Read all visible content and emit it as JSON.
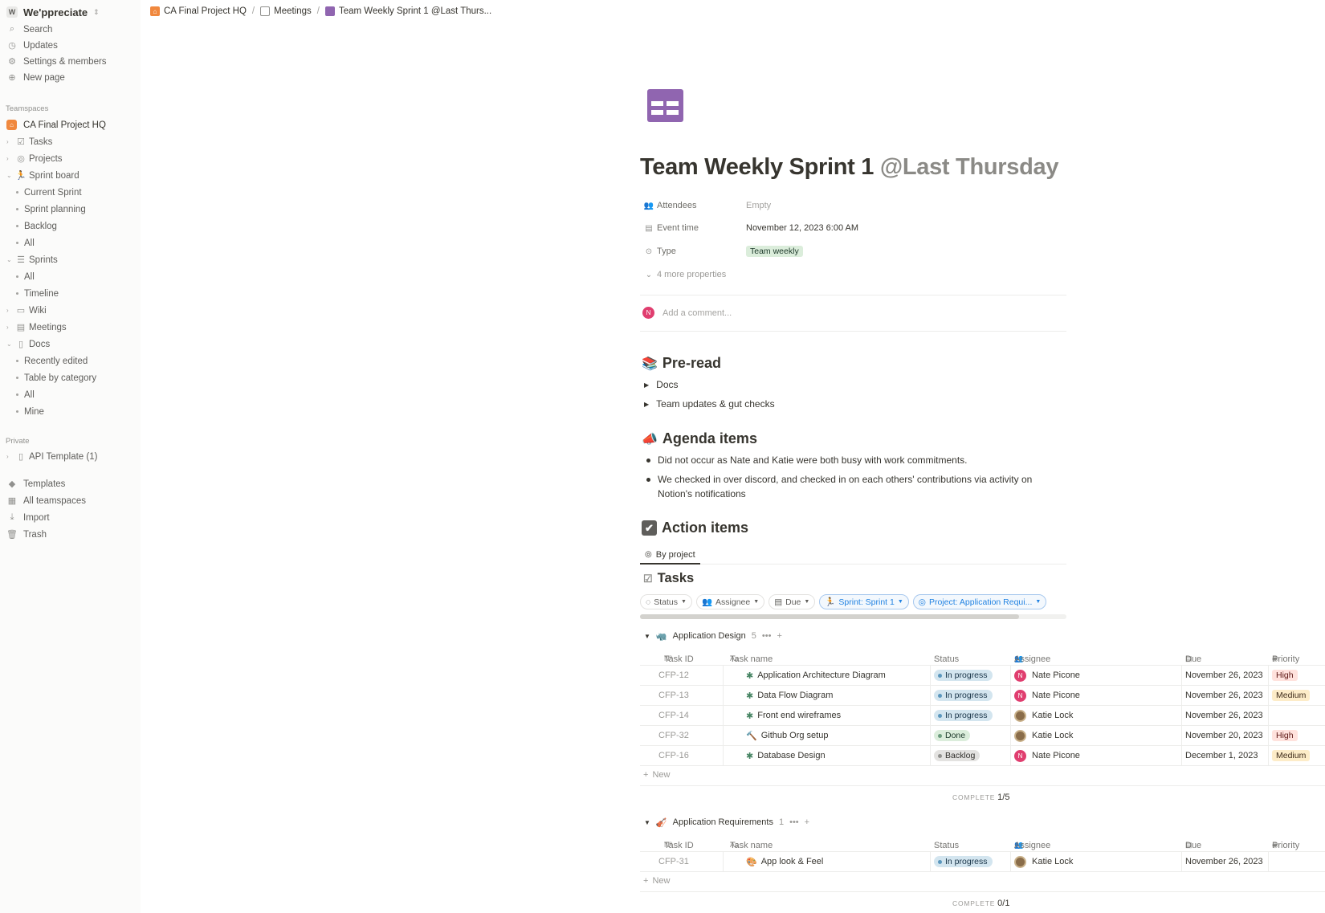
{
  "workspace": {
    "logo": "W",
    "name": "We'ppreciate"
  },
  "sidebar": {
    "top": [
      {
        "icon": "search-icon",
        "label": "Search"
      },
      {
        "icon": "clock-icon",
        "label": "Updates"
      },
      {
        "icon": "gear-icon",
        "label": "Settings & members"
      },
      {
        "icon": "plus-circle-icon",
        "label": "New page"
      }
    ],
    "teamspaces_label": "Teamspaces",
    "teamspace_name": "CA Final Project HQ",
    "tree": {
      "tasks": "Tasks",
      "projects": "Projects",
      "sprint_board": "Sprint board",
      "sprint_board_children": [
        "Current Sprint",
        "Sprint planning",
        "Backlog",
        "All"
      ],
      "sprints": "Sprints",
      "sprints_children": [
        "All",
        "Timeline"
      ],
      "wiki": "Wiki",
      "meetings": "Meetings",
      "docs": "Docs",
      "docs_children": [
        "Recently edited",
        "Table by category",
        "All",
        "Mine"
      ]
    },
    "private_label": "Private",
    "private_page": "API Template (1)",
    "bottom": [
      "Templates",
      "All teamspaces",
      "Import",
      "Trash"
    ]
  },
  "breadcrumb": [
    "CA Final Project HQ",
    "Meetings",
    "Team Weekly Sprint 1 @Last Thurs..."
  ],
  "page": {
    "title": "Team Weekly Sprint 1",
    "title_mention": "@Last Thursday",
    "properties": {
      "attendees_label": "Attendees",
      "attendees_value": "Empty",
      "event_time_label": "Event time",
      "event_time_value": "November 12, 2023 6:00 AM",
      "type_label": "Type",
      "type_value": "Team weekly",
      "more": "4 more properties"
    },
    "comment_avatar": "N",
    "comment_placeholder": "Add a comment...",
    "preread": {
      "emoji": "📚",
      "title": "Pre-read",
      "toggles": [
        "Docs",
        "Team updates & gut checks"
      ]
    },
    "agenda": {
      "emoji": "📣",
      "title": "Agenda items",
      "bullets": [
        "Did not occur as Nate and Katie were both busy with work commitments.",
        "We checked in over discord, and checked in on each others' contributions via activity on Notion's notifications"
      ]
    },
    "action": {
      "emoji": "✔",
      "title": "Action items"
    }
  },
  "db": {
    "view_tab": "By project",
    "title": "Tasks",
    "filters": {
      "status": "Status",
      "assignee": "Assignee",
      "due": "Due",
      "sprint": "Sprint: Sprint 1",
      "project": "Project: Application Requi..."
    },
    "headers": {
      "task_id": "Task ID",
      "task_name": "Task name",
      "status": "Status",
      "assignee": "Assignee",
      "due": "Due",
      "priority": "Priority"
    },
    "header_icons": {
      "task_id": "Nº",
      "task_name": "Aa"
    },
    "new_label": "New",
    "complete_label": "COMPLETE",
    "groups": [
      {
        "emoji": "🦏",
        "name": "Application Design",
        "count": "5",
        "complete": "1/5",
        "rows": [
          {
            "id": "CFP-12",
            "icon": "✱",
            "name": "Application Architecture Diagram",
            "status": "In progress",
            "status_class": "inprog",
            "assignee": "Nate Picone",
            "avatar": "N",
            "due": "November 26, 2023",
            "priority": "High",
            "priority_class": "high"
          },
          {
            "id": "CFP-13",
            "icon": "✱",
            "name": "Data Flow Diagram",
            "status": "In progress",
            "status_class": "inprog",
            "assignee": "Nate Picone",
            "avatar": "N",
            "due": "November 26, 2023",
            "priority": "Medium",
            "priority_class": "medium"
          },
          {
            "id": "CFP-14",
            "icon": "✱",
            "name": "Front end wireframes",
            "status": "In progress",
            "status_class": "inprog",
            "assignee": "Katie Lock",
            "avatar": "",
            "due": "November 26, 2023",
            "priority": "",
            "priority_class": ""
          },
          {
            "id": "CFP-32",
            "icon": "🔨",
            "name": "Github Org setup",
            "status": "Done",
            "status_class": "done",
            "assignee": "Katie Lock",
            "avatar": "",
            "due": "November 20, 2023",
            "priority": "High",
            "priority_class": "high"
          },
          {
            "id": "CFP-16",
            "icon": "✱",
            "name": "Database Design",
            "status": "Backlog",
            "status_class": "backlog",
            "assignee": "Nate Picone",
            "avatar": "N",
            "due": "December 1, 2023",
            "priority": "Medium",
            "priority_class": "medium"
          }
        ]
      },
      {
        "emoji": "🎻",
        "name": "Application Requirements",
        "count": "1",
        "complete": "0/1",
        "rows": [
          {
            "id": "CFP-31",
            "icon": "🎨",
            "name": "App look & Feel",
            "status": "In progress",
            "status_class": "inprog",
            "assignee": "Katie Lock",
            "avatar": "",
            "due": "November 26, 2023",
            "priority": "",
            "priority_class": ""
          }
        ]
      }
    ]
  }
}
